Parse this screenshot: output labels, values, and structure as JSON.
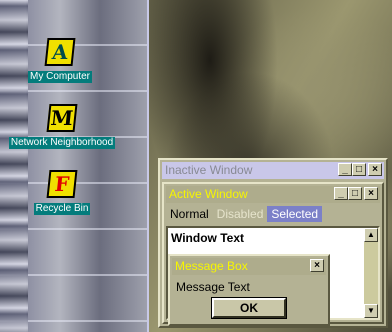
{
  "desktop": {
    "icons": [
      {
        "glyph": "A",
        "label": "My Computer",
        "icon_name": "my-computer-icon"
      },
      {
        "glyph": "M",
        "label": "Network Neighborhood",
        "icon_name": "network-neighborhood-icon"
      },
      {
        "glyph": "F",
        "label": "Recycle Bin",
        "icon_name": "recycle-bin-icon"
      }
    ]
  },
  "inactive_window": {
    "title": "Inactive Window"
  },
  "active_window": {
    "title": "Active Window",
    "menu": {
      "normal": "Normal",
      "disabled": "Disabled",
      "selected": "Selected"
    },
    "client_text": "Window Text"
  },
  "message_box": {
    "title": "Message Box",
    "text": "Message Text",
    "ok_label": "OK"
  },
  "window_buttons": {
    "minimize": "_",
    "maximize": "□",
    "close": "×"
  },
  "scroll": {
    "up": "▲",
    "down": "▼"
  },
  "colors": {
    "caption_bg": "#047c7c",
    "active_title_text": "#f6f600",
    "inactive_title_bg": "#c9c7e9",
    "selected_bg": "#7b80c8",
    "window_face": "#b4b294"
  }
}
